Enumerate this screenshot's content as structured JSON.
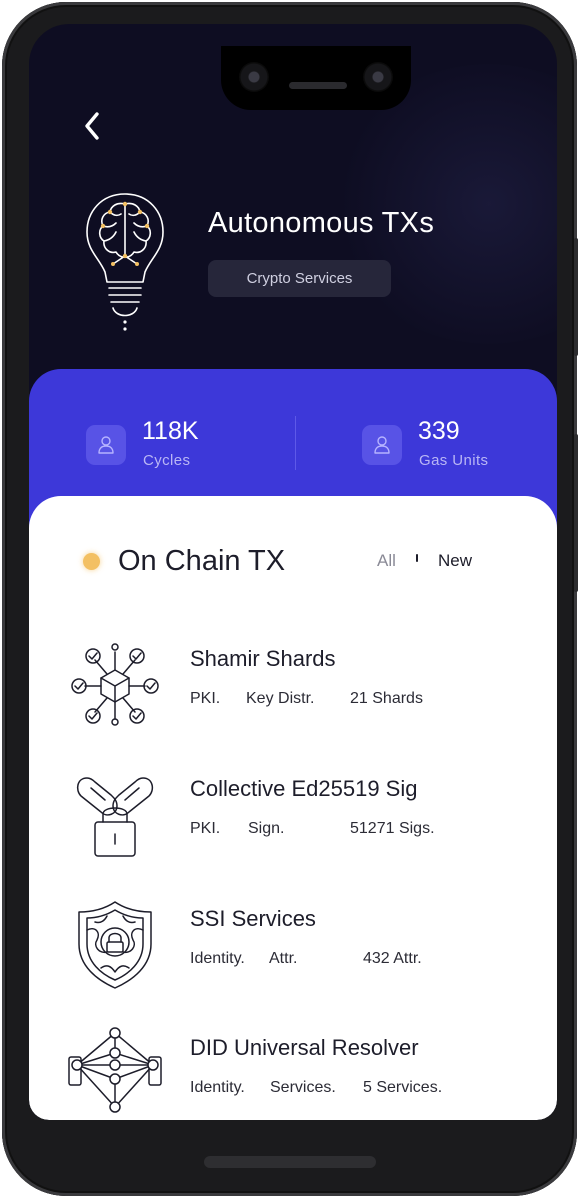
{
  "header": {
    "title": "Autonomous TXs",
    "tag": "Crypto Services"
  },
  "icons": {
    "back": "chevron-left-icon",
    "hero": "brain-lightbulb-icon",
    "user": "user-icon"
  },
  "stats": [
    {
      "value": "118K",
      "label": "Cycles"
    },
    {
      "value": "339",
      "label": "Gas Units"
    }
  ],
  "section": {
    "title": "On Chain TX",
    "filters": [
      "All",
      "New"
    ],
    "active_filter": "New"
  },
  "items": [
    {
      "name": "Shamir Shards",
      "meta": [
        "PKI.",
        "Key Distr.",
        "21 Shards"
      ],
      "icon": "network-nodes-icon"
    },
    {
      "name": "Collective Ed25519 Sig",
      "meta": [
        "PKI.",
        "Sign.",
        "51271 Sigs."
      ],
      "icon": "padlock-pills-icon"
    },
    {
      "name": "SSI Services",
      "meta": [
        "Identity.",
        "Attr.",
        "432 Attr."
      ],
      "icon": "shield-lock-icon"
    },
    {
      "name": "DID Universal Resolver",
      "meta": [
        "Identity.",
        "Services.",
        "5 Services."
      ],
      "icon": "neural-network-icon"
    }
  ],
  "colors": {
    "header_bg": "#0e0d22",
    "accent": "#3d38d9",
    "status_dot": "#f3c063",
    "panel_bg": "#ffffff"
  }
}
